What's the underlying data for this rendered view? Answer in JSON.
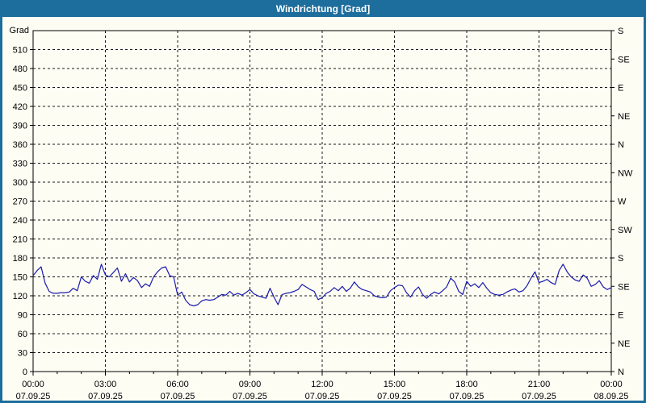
{
  "window": {
    "title": "Windrichtung [Grad]"
  },
  "colors": {
    "titlebar_bg": "#1d6d9d",
    "frame_border": "#1d6d9d",
    "chart_bg": "#fdfdf4",
    "plot_border": "#000000",
    "grid": "#1a1a1a",
    "line": "#1a1aae",
    "title_text": "#ffffff",
    "axis_text": "#000000"
  },
  "chart_data": {
    "type": "line",
    "title": "Windrichtung [Grad]",
    "ylabel": "Grad",
    "ylim": [
      0,
      540
    ],
    "xlim_hours": [
      0,
      24
    ],
    "grid": "dashed",
    "legend": "none",
    "y_ticks_left": [
      0,
      30,
      60,
      90,
      120,
      150,
      180,
      210,
      240,
      270,
      300,
      330,
      360,
      390,
      420,
      450,
      480,
      510
    ],
    "y_ticks_right": [
      {
        "deg": 0,
        "label": "N"
      },
      {
        "deg": 45,
        "label": "NE"
      },
      {
        "deg": 90,
        "label": "E"
      },
      {
        "deg": 135,
        "label": "SE"
      },
      {
        "deg": 180,
        "label": "S"
      },
      {
        "deg": 225,
        "label": "SW"
      },
      {
        "deg": 270,
        "label": "W"
      },
      {
        "deg": 315,
        "label": "NW"
      },
      {
        "deg": 360,
        "label": "N"
      },
      {
        "deg": 405,
        "label": "NE"
      },
      {
        "deg": 450,
        "label": "E"
      },
      {
        "deg": 495,
        "label": "SE"
      },
      {
        "deg": 540,
        "label": "S"
      }
    ],
    "x_ticks": [
      {
        "hour": 0,
        "time": "00:00",
        "date": "07.09.25"
      },
      {
        "hour": 3,
        "time": "03:00",
        "date": "07.09.25"
      },
      {
        "hour": 6,
        "time": "06:00",
        "date": "07.09.25"
      },
      {
        "hour": 9,
        "time": "09:00",
        "date": "07.09.25"
      },
      {
        "hour": 12,
        "time": "12:00",
        "date": "07.09.25"
      },
      {
        "hour": 15,
        "time": "15:00",
        "date": "07.09.25"
      },
      {
        "hour": 18,
        "time": "18:00",
        "date": "07.09.25"
      },
      {
        "hour": 21,
        "time": "21:00",
        "date": "07.09.25"
      },
      {
        "hour": 24,
        "time": "00:00",
        "date": "08.09.25"
      }
    ],
    "minor_x_tick_every_hours": 1,
    "series": [
      {
        "name": "Windrichtung",
        "color": "#1a1aae",
        "start_hour": 0,
        "step_minutes": 10,
        "values": [
          152,
          160,
          166,
          140,
          127,
          124,
          124,
          125,
          125,
          126,
          132,
          128,
          150,
          143,
          140,
          152,
          146,
          170,
          153,
          150,
          157,
          164,
          143,
          155,
          142,
          149,
          144,
          133,
          139,
          135,
          150,
          158,
          164,
          166,
          152,
          150,
          121,
          126,
          113,
          106,
          104,
          106,
          112,
          114,
          113,
          114,
          118,
          122,
          121,
          127,
          121,
          124,
          121,
          125,
          130,
          123,
          120,
          118,
          116,
          132,
          118,
          106,
          122,
          124,
          125,
          127,
          130,
          138,
          134,
          130,
          127,
          114,
          117,
          124,
          127,
          133,
          128,
          135,
          127,
          132,
          142,
          134,
          130,
          128,
          126,
          120,
          118,
          117,
          118,
          128,
          133,
          137,
          136,
          125,
          118,
          128,
          134,
          122,
          116,
          122,
          126,
          123,
          128,
          134,
          148,
          142,
          127,
          122,
          143,
          135,
          139,
          133,
          141,
          132,
          125,
          122,
          121,
          122,
          126,
          129,
          131,
          126,
          128,
          136,
          148,
          158,
          141,
          143,
          146,
          141,
          138,
          160,
          170,
          158,
          150,
          145,
          143,
          153,
          148,
          135,
          138,
          144,
          134,
          130,
          133
        ]
      }
    ]
  }
}
